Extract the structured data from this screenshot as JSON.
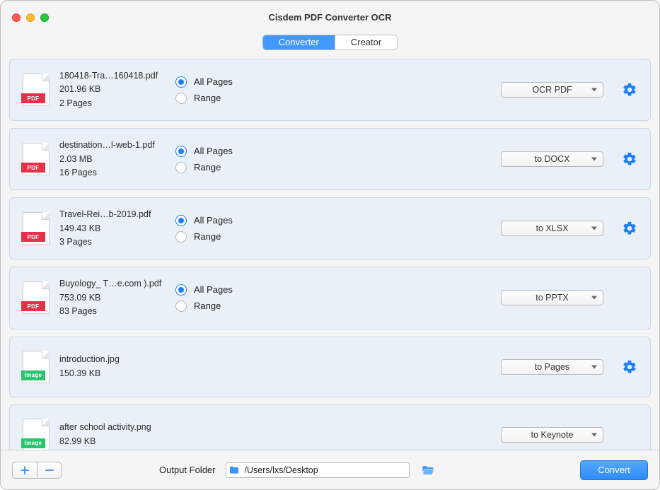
{
  "title": "Cisdem PDF Converter OCR",
  "tabs": {
    "converter": "Converter",
    "creator": "Creator"
  },
  "radio_labels": {
    "all": "All Pages",
    "range": "Range"
  },
  "files": [
    {
      "name": "180418-Tra…160418.pdf",
      "size": "201.96 KB",
      "pages": "2 Pages",
      "kind": "pdf",
      "badge": "PDF",
      "format": "OCR PDF",
      "show_pages": true,
      "show_gear": true
    },
    {
      "name": "destination…l-web-1.pdf",
      "size": "2.03 MB",
      "pages": "16 Pages",
      "kind": "pdf",
      "badge": "PDF",
      "format": "to DOCX",
      "show_pages": true,
      "show_gear": true
    },
    {
      "name": "Travel-Rei…b-2019.pdf",
      "size": "149.43 KB",
      "pages": "3 Pages",
      "kind": "pdf",
      "badge": "PDF",
      "format": "to XLSX",
      "show_pages": true,
      "show_gear": true
    },
    {
      "name": "Buyology_ T…e.com ).pdf",
      "size": "753.09 KB",
      "pages": "83 Pages",
      "kind": "pdf",
      "badge": "PDF",
      "format": "to PPTX",
      "show_pages": true,
      "show_gear": false
    },
    {
      "name": "introduction.jpg",
      "size": "150.39 KB",
      "pages": "",
      "kind": "img",
      "badge": "Image",
      "format": "to Pages",
      "show_pages": false,
      "show_gear": true
    },
    {
      "name": "after school activity.png",
      "size": "82.99 KB",
      "pages": "",
      "kind": "img",
      "badge": "Image",
      "format": "to Keynote",
      "show_pages": false,
      "show_gear": false
    }
  ],
  "footer": {
    "output_label": "Output Folder",
    "output_path": "/Users/lxs/Desktop",
    "convert": "Convert"
  }
}
